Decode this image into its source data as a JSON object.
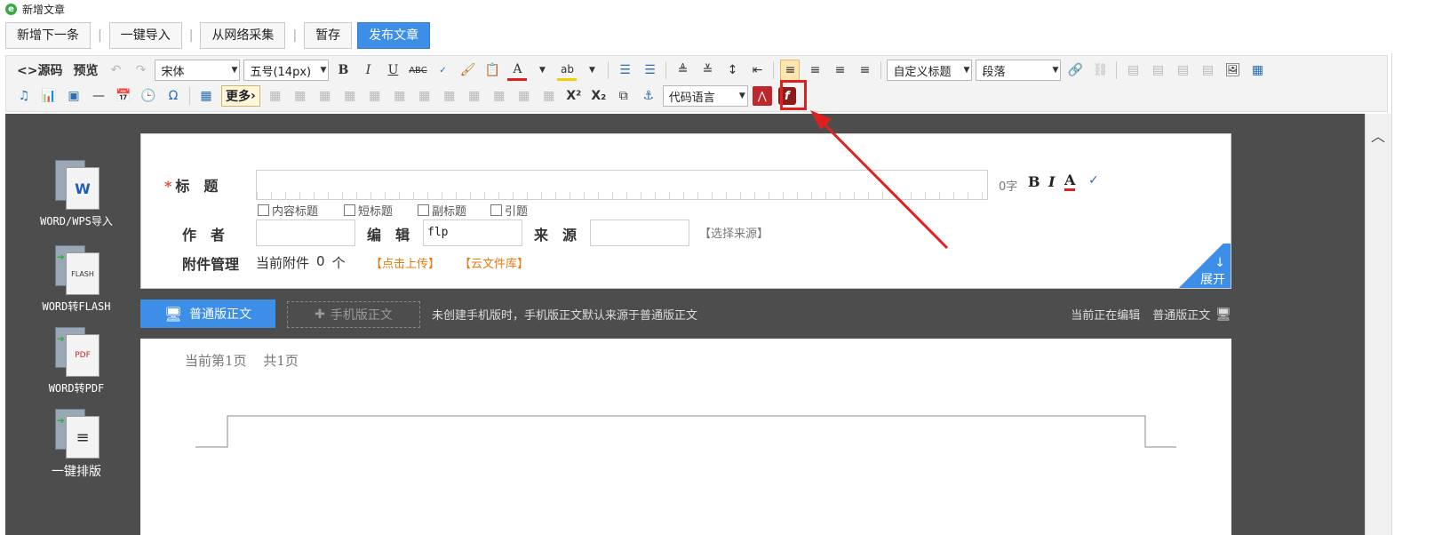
{
  "window": {
    "title": "新增文章"
  },
  "topbar": {
    "next": "新增下一条",
    "import": "一键导入",
    "collect": "从网络采集",
    "save": "暂存",
    "publish": "发布文章"
  },
  "toolbar": {
    "source": "<>源码",
    "preview": "预览",
    "font_family": "宋体",
    "font_size": "五号(14px)",
    "heading_style": "自定义标题",
    "paragraph": "段落",
    "more": "更多",
    "code_language": "代码语言"
  },
  "sidebar": [
    {
      "label": "WORD/WPS导入",
      "icon": "word-icon",
      "glyph": "W"
    },
    {
      "label": "WORD转FLASH",
      "icon": "flash-icon",
      "glyph": "FLASH"
    },
    {
      "label": "WORD转PDF",
      "icon": "pdf-icon",
      "glyph": "PDF"
    },
    {
      "label": "一键排版",
      "icon": "layout-icon",
      "glyph": "≡"
    }
  ],
  "form": {
    "title_label": "标　题",
    "char_count": "0字",
    "options": [
      "内容标题",
      "短标题",
      "副标题",
      "引题"
    ],
    "author_label": "作　者",
    "author_value": "",
    "editor_label": "编　辑",
    "editor_value": "flp",
    "source_label": "来　源",
    "source_value": "",
    "choose_source": "【选择来源】",
    "attachment_label": "附件管理",
    "attachment_text": "当前附件",
    "attachment_count": "0",
    "attachment_unit": "个",
    "upload": "【点击上传】",
    "cloud": "【云文件库】",
    "expand": "展开"
  },
  "tabs": {
    "normal": "普通版正文",
    "mobile": "手机版正文",
    "note": "未创建手机版时，手机版正文默认来源于普通版正文",
    "editing_prefix": "当前正在编辑",
    "editing_value": "普通版正文"
  },
  "page": {
    "current": "当前第1页",
    "total": "共1页"
  },
  "colors": {
    "accent": "#3d8ee6",
    "highlight": "#e02020",
    "link": "#e87a12"
  }
}
